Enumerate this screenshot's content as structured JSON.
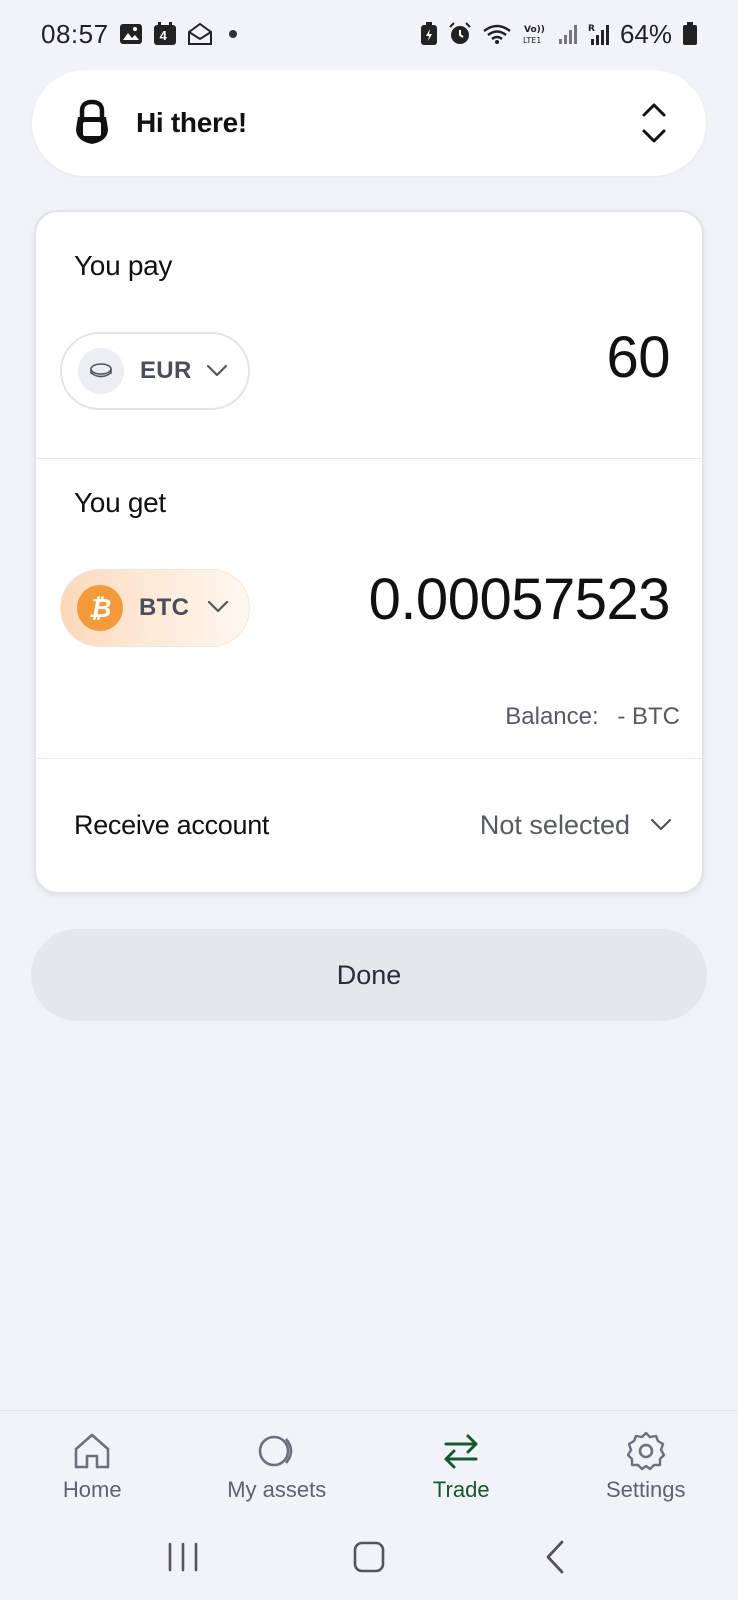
{
  "status_bar": {
    "time": "08:57",
    "notification_badge": "4",
    "battery": "64%",
    "icons": [
      "image-icon",
      "calendar-icon",
      "mail-open-icon",
      "dot-icon",
      "battery-saver-icon",
      "alarm-icon",
      "wifi-icon",
      "volte-icon",
      "signal-icon",
      "signal-roaming-icon",
      "battery-icon"
    ]
  },
  "account_bar": {
    "greeting": "Hi there!",
    "icon": "lock-icon",
    "toggle_icon": "expand-collapse-icon"
  },
  "trade_card": {
    "pay": {
      "label": "You pay",
      "currency": "EUR",
      "amount": "60"
    },
    "get": {
      "label": "You get",
      "currency": "BTC",
      "amount": "0.00057523",
      "balance_label": "Balance:",
      "balance_value": "- BTC"
    },
    "receive": {
      "label": "Receive account",
      "value": "Not selected"
    }
  },
  "done_label": "Done",
  "bottom_nav": {
    "items": [
      {
        "label": "Home",
        "icon": "home-icon",
        "active": false
      },
      {
        "label": "My assets",
        "icon": "assets-icon",
        "active": false
      },
      {
        "label": "Trade",
        "icon": "trade-icon",
        "active": true
      },
      {
        "label": "Settings",
        "icon": "gear-icon",
        "active": false
      }
    ]
  },
  "colors": {
    "background": "#f2f3f8",
    "accent_active": "#14592d",
    "btc_orange": "#f59a38"
  }
}
